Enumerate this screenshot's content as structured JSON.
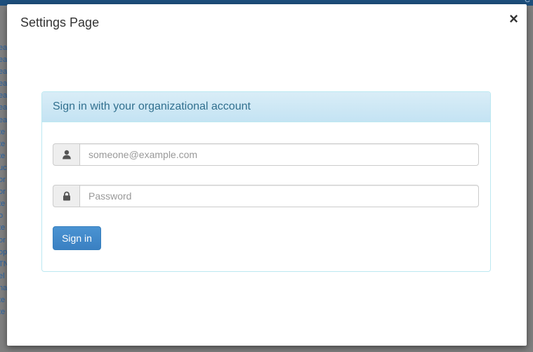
{
  "background": {
    "topbar_text": "C",
    "list_fragments": [
      "ea",
      "ea",
      "ea",
      "ea",
      "ea",
      "ea",
      "ea",
      "te",
      "te",
      "te",
      "uc",
      "or",
      "or",
      "te",
      "o",
      "te",
      "or",
      "op",
      "TN",
      "el",
      "na",
      "te",
      "te"
    ]
  },
  "modal": {
    "title": "Settings Page",
    "close_label": "×"
  },
  "login_panel": {
    "heading": "Sign in with your organizational account",
    "username": {
      "value": "",
      "placeholder": "someone@example.com",
      "icon": "user-icon"
    },
    "password": {
      "value": "",
      "placeholder": "Password",
      "icon": "lock-icon"
    },
    "submit_label": "Sign in"
  },
  "colors": {
    "primary_button": "#428bca",
    "panel_heading_bg": "#d9edf7",
    "panel_heading_text": "#31708f",
    "panel_border": "#bce8f1"
  }
}
